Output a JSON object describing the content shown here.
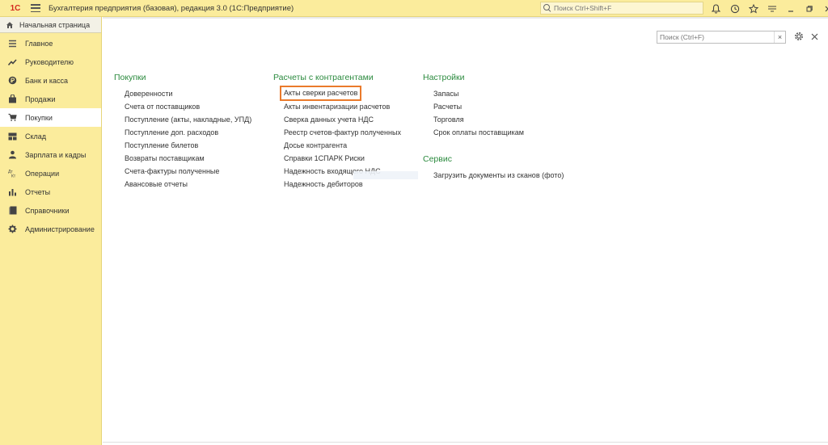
{
  "titlebar": {
    "logo": "1С",
    "title": "Бухгалтерия предприятия (базовая), редакция 3.0  (1С:Предприятие)",
    "search_placeholder": "Поиск Ctrl+Shift+F"
  },
  "sidebar": {
    "home_tab": "Начальная страница",
    "items": [
      {
        "label": "Главное",
        "icon": "list-icon"
      },
      {
        "label": "Руководителю",
        "icon": "trend-icon"
      },
      {
        "label": "Банк и касса",
        "icon": "coin-icon"
      },
      {
        "label": "Продажи",
        "icon": "bag-icon"
      },
      {
        "label": "Покупки",
        "icon": "cart-icon"
      },
      {
        "label": "Склад",
        "icon": "warehouse-icon"
      },
      {
        "label": "Зарплата и кадры",
        "icon": "person-icon"
      },
      {
        "label": "Операции",
        "icon": "operations-icon"
      },
      {
        "label": "Отчеты",
        "icon": "bar-chart-icon"
      },
      {
        "label": "Справочники",
        "icon": "book-icon"
      },
      {
        "label": "Администрирование",
        "icon": "gear-icon"
      }
    ],
    "active_index": 4
  },
  "main": {
    "search_placeholder": "Поиск (Ctrl+F)",
    "columns": [
      {
        "title": "Покупки",
        "links": [
          "Доверенности",
          "Счета от поставщиков",
          "Поступление (акты, накладные, УПД)",
          "Поступление доп. расходов",
          "Поступление билетов",
          "Возвраты поставщикам",
          "Счета-фактуры полученные",
          "Авансовые отчеты"
        ]
      },
      {
        "title": "Расчеты с контрагентами",
        "links": [
          "Акты сверки расчетов",
          "Акты инвентаризации расчетов",
          "Сверка данных учета НДС",
          "Реестр счетов-фактур полученных",
          "Досье контрагента",
          "Справки 1СПАРК Риски",
          "Надежность входящего НДС",
          "Надежность дебиторов"
        ]
      },
      {
        "title": "Настройки",
        "links": [
          "Запасы",
          "Расчеты",
          "Торговля",
          "Срок оплаты поставщикам"
        ]
      },
      {
        "title": "Сервис",
        "links": [
          "Загрузить документы из сканов (фото)"
        ]
      }
    ]
  }
}
